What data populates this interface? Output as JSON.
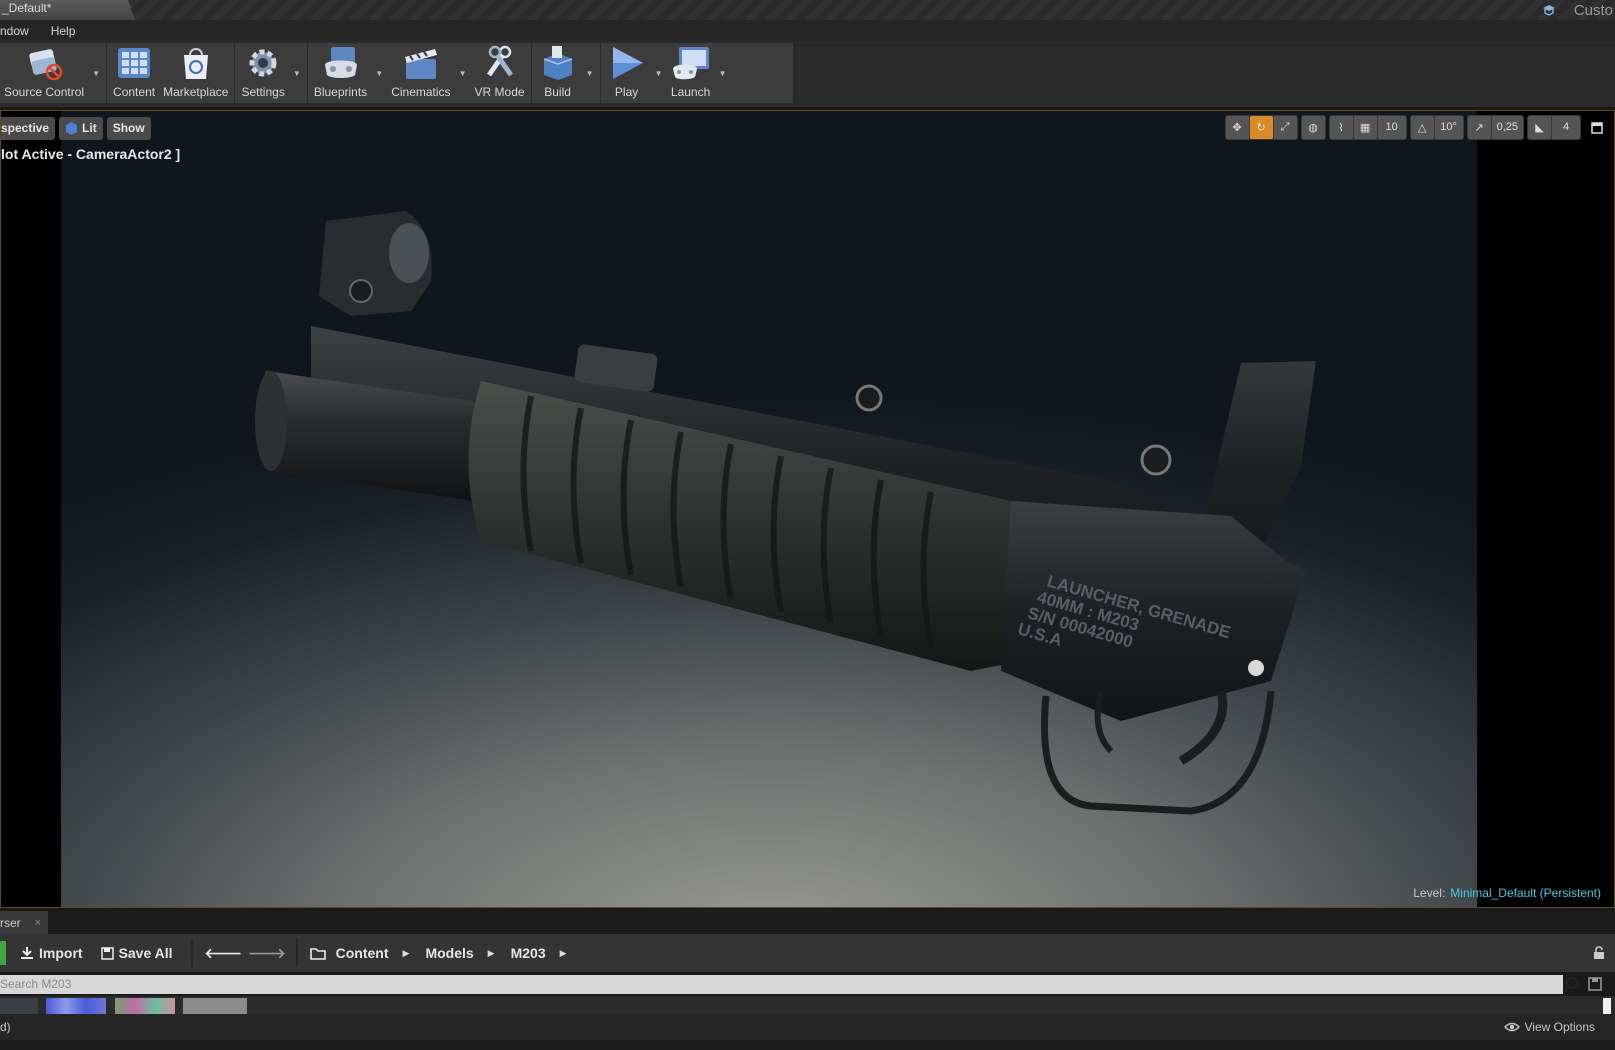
{
  "window": {
    "tab_title": "_Default*",
    "right_label": "Custo"
  },
  "menu": {
    "items": [
      "ndow",
      "Help"
    ]
  },
  "toolbar": {
    "source_control": "Source Control",
    "content": "Content",
    "marketplace": "Marketplace",
    "settings": "Settings",
    "blueprints": "Blueprints",
    "cinematics": "Cinematics",
    "vr_mode": "VR Mode",
    "build": "Build",
    "play": "Play",
    "launch": "Launch"
  },
  "viewport": {
    "perspective": "spective",
    "lit": "Lit",
    "show": "Show",
    "camera_label": "lot Active - CameraActor2 ]",
    "grid_snap": "10",
    "rotation_snap": "10°",
    "scale_snap": "0,25",
    "camera_speed": "4",
    "level_prefix": "Level:",
    "level_name": "Minimal_Default (Persistent)",
    "engraving": [
      "LAUNCHER, GRENADE",
      "40MM : M203",
      "S/N 00042000",
      "U.S.A"
    ]
  },
  "content_browser": {
    "tab_label": "rser",
    "tab_close": "×",
    "import": "Import",
    "save_all": "Save All",
    "path": [
      "Content",
      "Models",
      "M203"
    ],
    "search_placeholder": "Search M203",
    "status": "d)",
    "view_options": "View Options"
  },
  "colors": {
    "accent_orange": "#d88b26",
    "level_cyan": "#49c6e2",
    "viewport_border": "#5e4a1e",
    "green": "#3ea83e"
  }
}
